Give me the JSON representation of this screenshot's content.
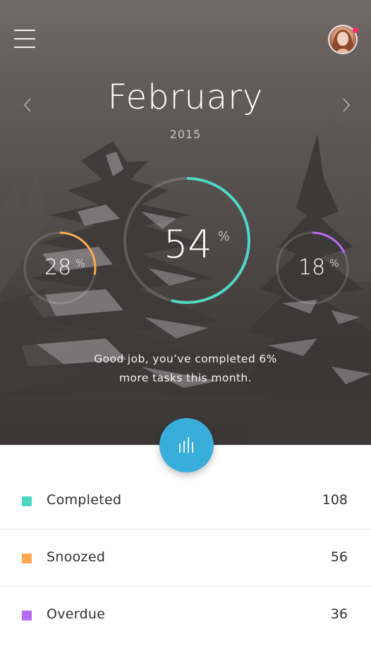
{
  "header": {
    "menu_icon": "hamburger-menu-icon",
    "avatar_icon": "user-avatar",
    "notification_color": "#ff2d6a"
  },
  "calendar": {
    "month": "February",
    "year": "2015",
    "prev_icon": "chevron-left-icon",
    "next_icon": "chevron-right-icon"
  },
  "gauges": [
    {
      "id": "completed",
      "value": 54,
      "fraction": 0.54,
      "num": "54",
      "unit": "%",
      "color": "#4fd6c4"
    },
    {
      "id": "snoozed",
      "value": 28,
      "fraction": 0.28,
      "num": "28",
      "unit": "%",
      "color": "#fda952"
    },
    {
      "id": "overdue",
      "value": 18,
      "fraction": 0.18,
      "num": "18",
      "unit": "%",
      "color": "#b76bf0"
    }
  ],
  "message": {
    "line1": "Good job, you’ve completed 6%",
    "line2": "more tasks this month."
  },
  "fab": {
    "icon": "bar-chart-icon",
    "color": "#3aaedb"
  },
  "stats": [
    {
      "label": "Completed",
      "value": "108",
      "color": "#4fd6c4"
    },
    {
      "label": "Snoozed",
      "value": "56",
      "color": "#fda952"
    },
    {
      "label": "Overdue",
      "value": "36",
      "color": "#b76bf0"
    }
  ]
}
